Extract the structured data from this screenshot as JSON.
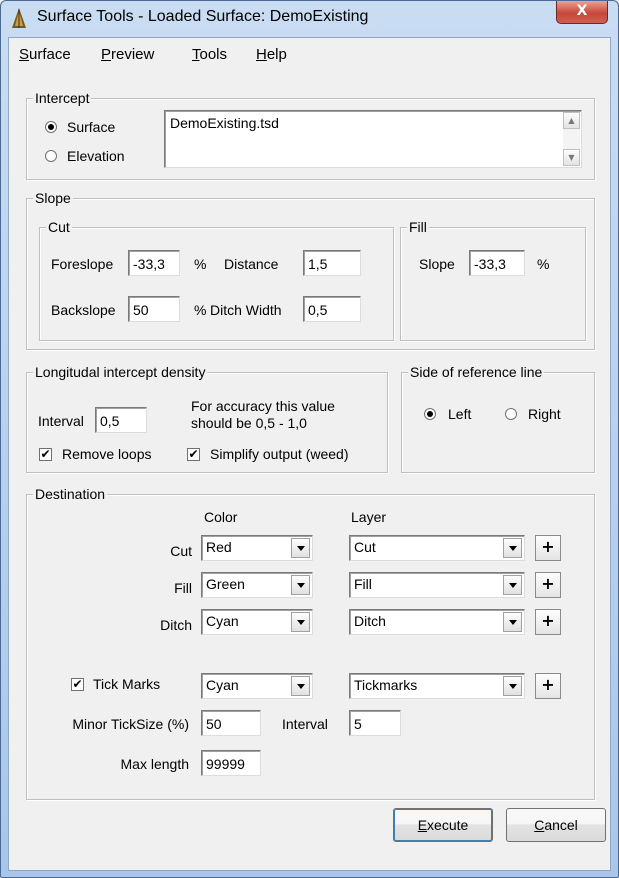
{
  "window": {
    "title": "Surface Tools - Loaded Surface: DemoExisting",
    "close_glyph": "X"
  },
  "menu": [
    {
      "key": "S",
      "rest": "urface"
    },
    {
      "key": "P",
      "rest": "review"
    },
    {
      "key": "T",
      "rest": "ools"
    },
    {
      "key": "H",
      "rest": "elp"
    }
  ],
  "intercept": {
    "legend": "Intercept",
    "surface_label": "Surface",
    "elevation_label": "Elevation",
    "selected": "Surface",
    "file_text": "DemoExisting.tsd"
  },
  "slope": {
    "legend": "Slope",
    "cut": {
      "legend": "Cut",
      "foreslope_label": "Foreslope",
      "foreslope_value": "-33,3",
      "foreslope_unit": "%",
      "distance_label": "Distance",
      "distance_value": "1,5",
      "backslope_label": "Backslope",
      "backslope_value": "50",
      "backslope_unit": "%",
      "ditch_width_label": "Ditch Width",
      "ditch_width_value": "0,5"
    },
    "fill": {
      "legend": "Fill",
      "slope_label": "Slope",
      "slope_value": "-33,3",
      "slope_unit": "%"
    }
  },
  "density": {
    "legend": "Longitudal intercept density",
    "interval_label": "Interval",
    "interval_value": "0,5",
    "hint_line1": "For accuracy this value",
    "hint_line2": "should be 0,5 - 1,0",
    "remove_loops_label": "Remove loops",
    "remove_loops_checked": true,
    "simplify_label": "Simplify output (weed)",
    "simplify_checked": true
  },
  "side": {
    "legend": "Side of reference line",
    "left_label": "Left",
    "right_label": "Right",
    "selected": "Left"
  },
  "destination": {
    "legend": "Destination",
    "color_header": "Color",
    "layer_header": "Layer",
    "rows": [
      {
        "label": "Cut",
        "color": "Red",
        "layer": "Cut"
      },
      {
        "label": "Fill",
        "color": "Green",
        "layer": "Fill"
      },
      {
        "label": "Ditch",
        "color": "Cyan",
        "layer": "Ditch"
      }
    ],
    "tick_marks_label": "Tick Marks",
    "tick_marks_checked": true,
    "tick_color": "Cyan",
    "tick_layer": "Tickmarks",
    "minor_ticksize_label": "Minor TickSize (%)",
    "minor_ticksize_value": "50",
    "interval_label": "Interval",
    "interval_value": "5",
    "max_length_label": "Max length",
    "max_length_value": "99999",
    "plus_glyph": "+"
  },
  "buttons": {
    "execute_key": "E",
    "execute_rest": "xecute",
    "cancel_key": "C",
    "cancel_rest": "ancel"
  }
}
